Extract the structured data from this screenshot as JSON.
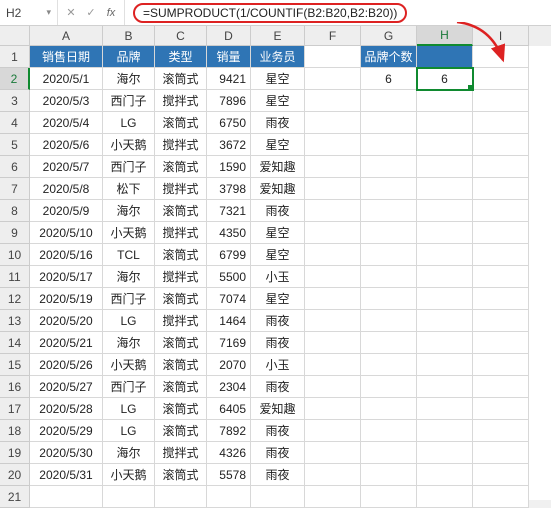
{
  "namebox": "H2",
  "fx_label": "fx",
  "formula": "=SUMPRODUCT(1/COUNTIF(B2:B20,B2:B20))",
  "columns": [
    "A",
    "B",
    "C",
    "D",
    "E",
    "F",
    "G",
    "H",
    "I"
  ],
  "active_col_index": 7,
  "active_row": 2,
  "headers": [
    "销售日期",
    "品牌",
    "类型",
    "销量",
    "业务员"
  ],
  "rows": [
    [
      "2020/5/1",
      "海尔",
      "滚筒式",
      "9421",
      "星空"
    ],
    [
      "2020/5/3",
      "西门子",
      "搅拌式",
      "7896",
      "星空"
    ],
    [
      "2020/5/4",
      "LG",
      "滚筒式",
      "6750",
      "雨夜"
    ],
    [
      "2020/5/6",
      "小天鹅",
      "搅拌式",
      "3672",
      "星空"
    ],
    [
      "2020/5/7",
      "西门子",
      "滚筒式",
      "1590",
      "爱知趣"
    ],
    [
      "2020/5/8",
      "松下",
      "搅拌式",
      "3798",
      "爱知趣"
    ],
    [
      "2020/5/9",
      "海尔",
      "滚筒式",
      "7321",
      "雨夜"
    ],
    [
      "2020/5/10",
      "小天鹅",
      "搅拌式",
      "4350",
      "星空"
    ],
    [
      "2020/5/16",
      "TCL",
      "滚筒式",
      "6799",
      "星空"
    ],
    [
      "2020/5/17",
      "海尔",
      "搅拌式",
      "5500",
      "小玉"
    ],
    [
      "2020/5/19",
      "西门子",
      "滚筒式",
      "7074",
      "星空"
    ],
    [
      "2020/5/20",
      "LG",
      "搅拌式",
      "1464",
      "雨夜"
    ],
    [
      "2020/5/21",
      "海尔",
      "滚筒式",
      "7169",
      "雨夜"
    ],
    [
      "2020/5/26",
      "小天鹅",
      "滚筒式",
      "2070",
      "小玉"
    ],
    [
      "2020/5/27",
      "西门子",
      "滚筒式",
      "2304",
      "雨夜"
    ],
    [
      "2020/5/28",
      "LG",
      "滚筒式",
      "6405",
      "爱知趣"
    ],
    [
      "2020/5/29",
      "LG",
      "滚筒式",
      "7892",
      "雨夜"
    ],
    [
      "2020/5/30",
      "海尔",
      "搅拌式",
      "4326",
      "雨夜"
    ],
    [
      "2020/5/31",
      "小天鹅",
      "滚筒式",
      "5578",
      "雨夜"
    ]
  ],
  "side_header": "品牌个数",
  "side_g2": "6",
  "side_h2": "6",
  "row_count": 21
}
